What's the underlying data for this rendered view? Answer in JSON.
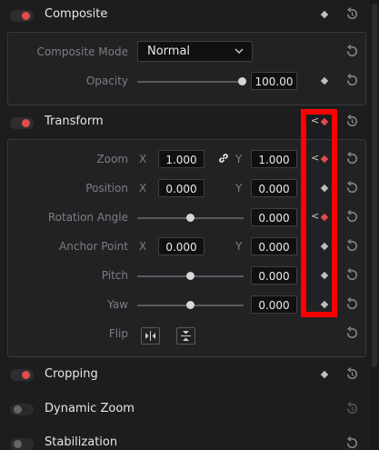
{
  "sections": {
    "composite": {
      "title": "Composite"
    },
    "transform": {
      "title": "Transform"
    },
    "cropping": {
      "title": "Cropping"
    },
    "dynamic_zoom": {
      "title": "Dynamic Zoom"
    },
    "stabilization": {
      "title": "Stabilization"
    }
  },
  "composite": {
    "mode_label": "Composite Mode",
    "mode_value": "Normal",
    "opacity_label": "Opacity",
    "opacity_value": "100.00",
    "opacity_fraction": 1.0
  },
  "transform": {
    "zoom": {
      "label": "Zoom",
      "x_axis": "X",
      "x": "1.000",
      "y_axis": "Y",
      "y": "1.000"
    },
    "position": {
      "label": "Position",
      "x_axis": "X",
      "x": "0.000",
      "y_axis": "Y",
      "y": "0.000"
    },
    "rotation": {
      "label": "Rotation Angle",
      "value": "0.000",
      "fraction": 0.5
    },
    "anchor": {
      "label": "Anchor Point",
      "x_axis": "X",
      "x": "0.000",
      "y_axis": "Y",
      "y": "0.000"
    },
    "pitch": {
      "label": "Pitch",
      "value": "0.000",
      "fraction": 0.5
    },
    "yaw": {
      "label": "Yaw",
      "value": "0.000",
      "fraction": 0.5
    },
    "flip": {
      "label": "Flip"
    }
  },
  "colors": {
    "accent_red": "#e34b4b",
    "highlight": "#ff0000"
  },
  "icons": [
    "keyframe-diamond-icon",
    "reset-icon",
    "link-icon",
    "chevron-down-icon",
    "flip-horizontal-icon",
    "flip-vertical-icon",
    "prev-keyframe-icon"
  ]
}
